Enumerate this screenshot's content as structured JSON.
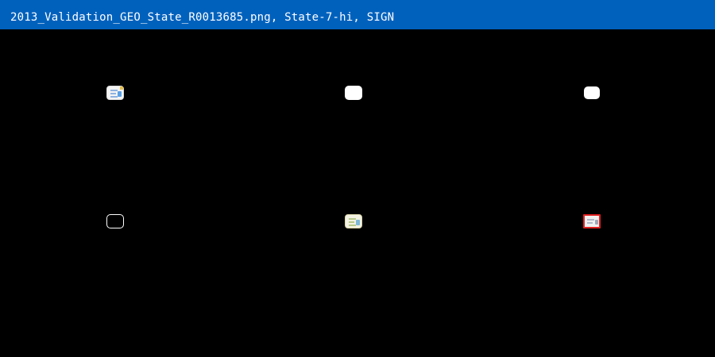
{
  "header": {
    "title": "2013_Validation_GEO_State_R0013685.png, State-7-hi, SIGN"
  },
  "colors": {
    "title_bar": "#0061bd",
    "background": "#000000",
    "highlight_box": "#e02020"
  },
  "panels": [
    {
      "variant": "original-color-icon"
    },
    {
      "variant": "white-mask"
    },
    {
      "variant": "white-mask"
    },
    {
      "variant": "outline-contour"
    },
    {
      "variant": "tinted-color-icon"
    },
    {
      "variant": "red-bounding-box"
    }
  ]
}
